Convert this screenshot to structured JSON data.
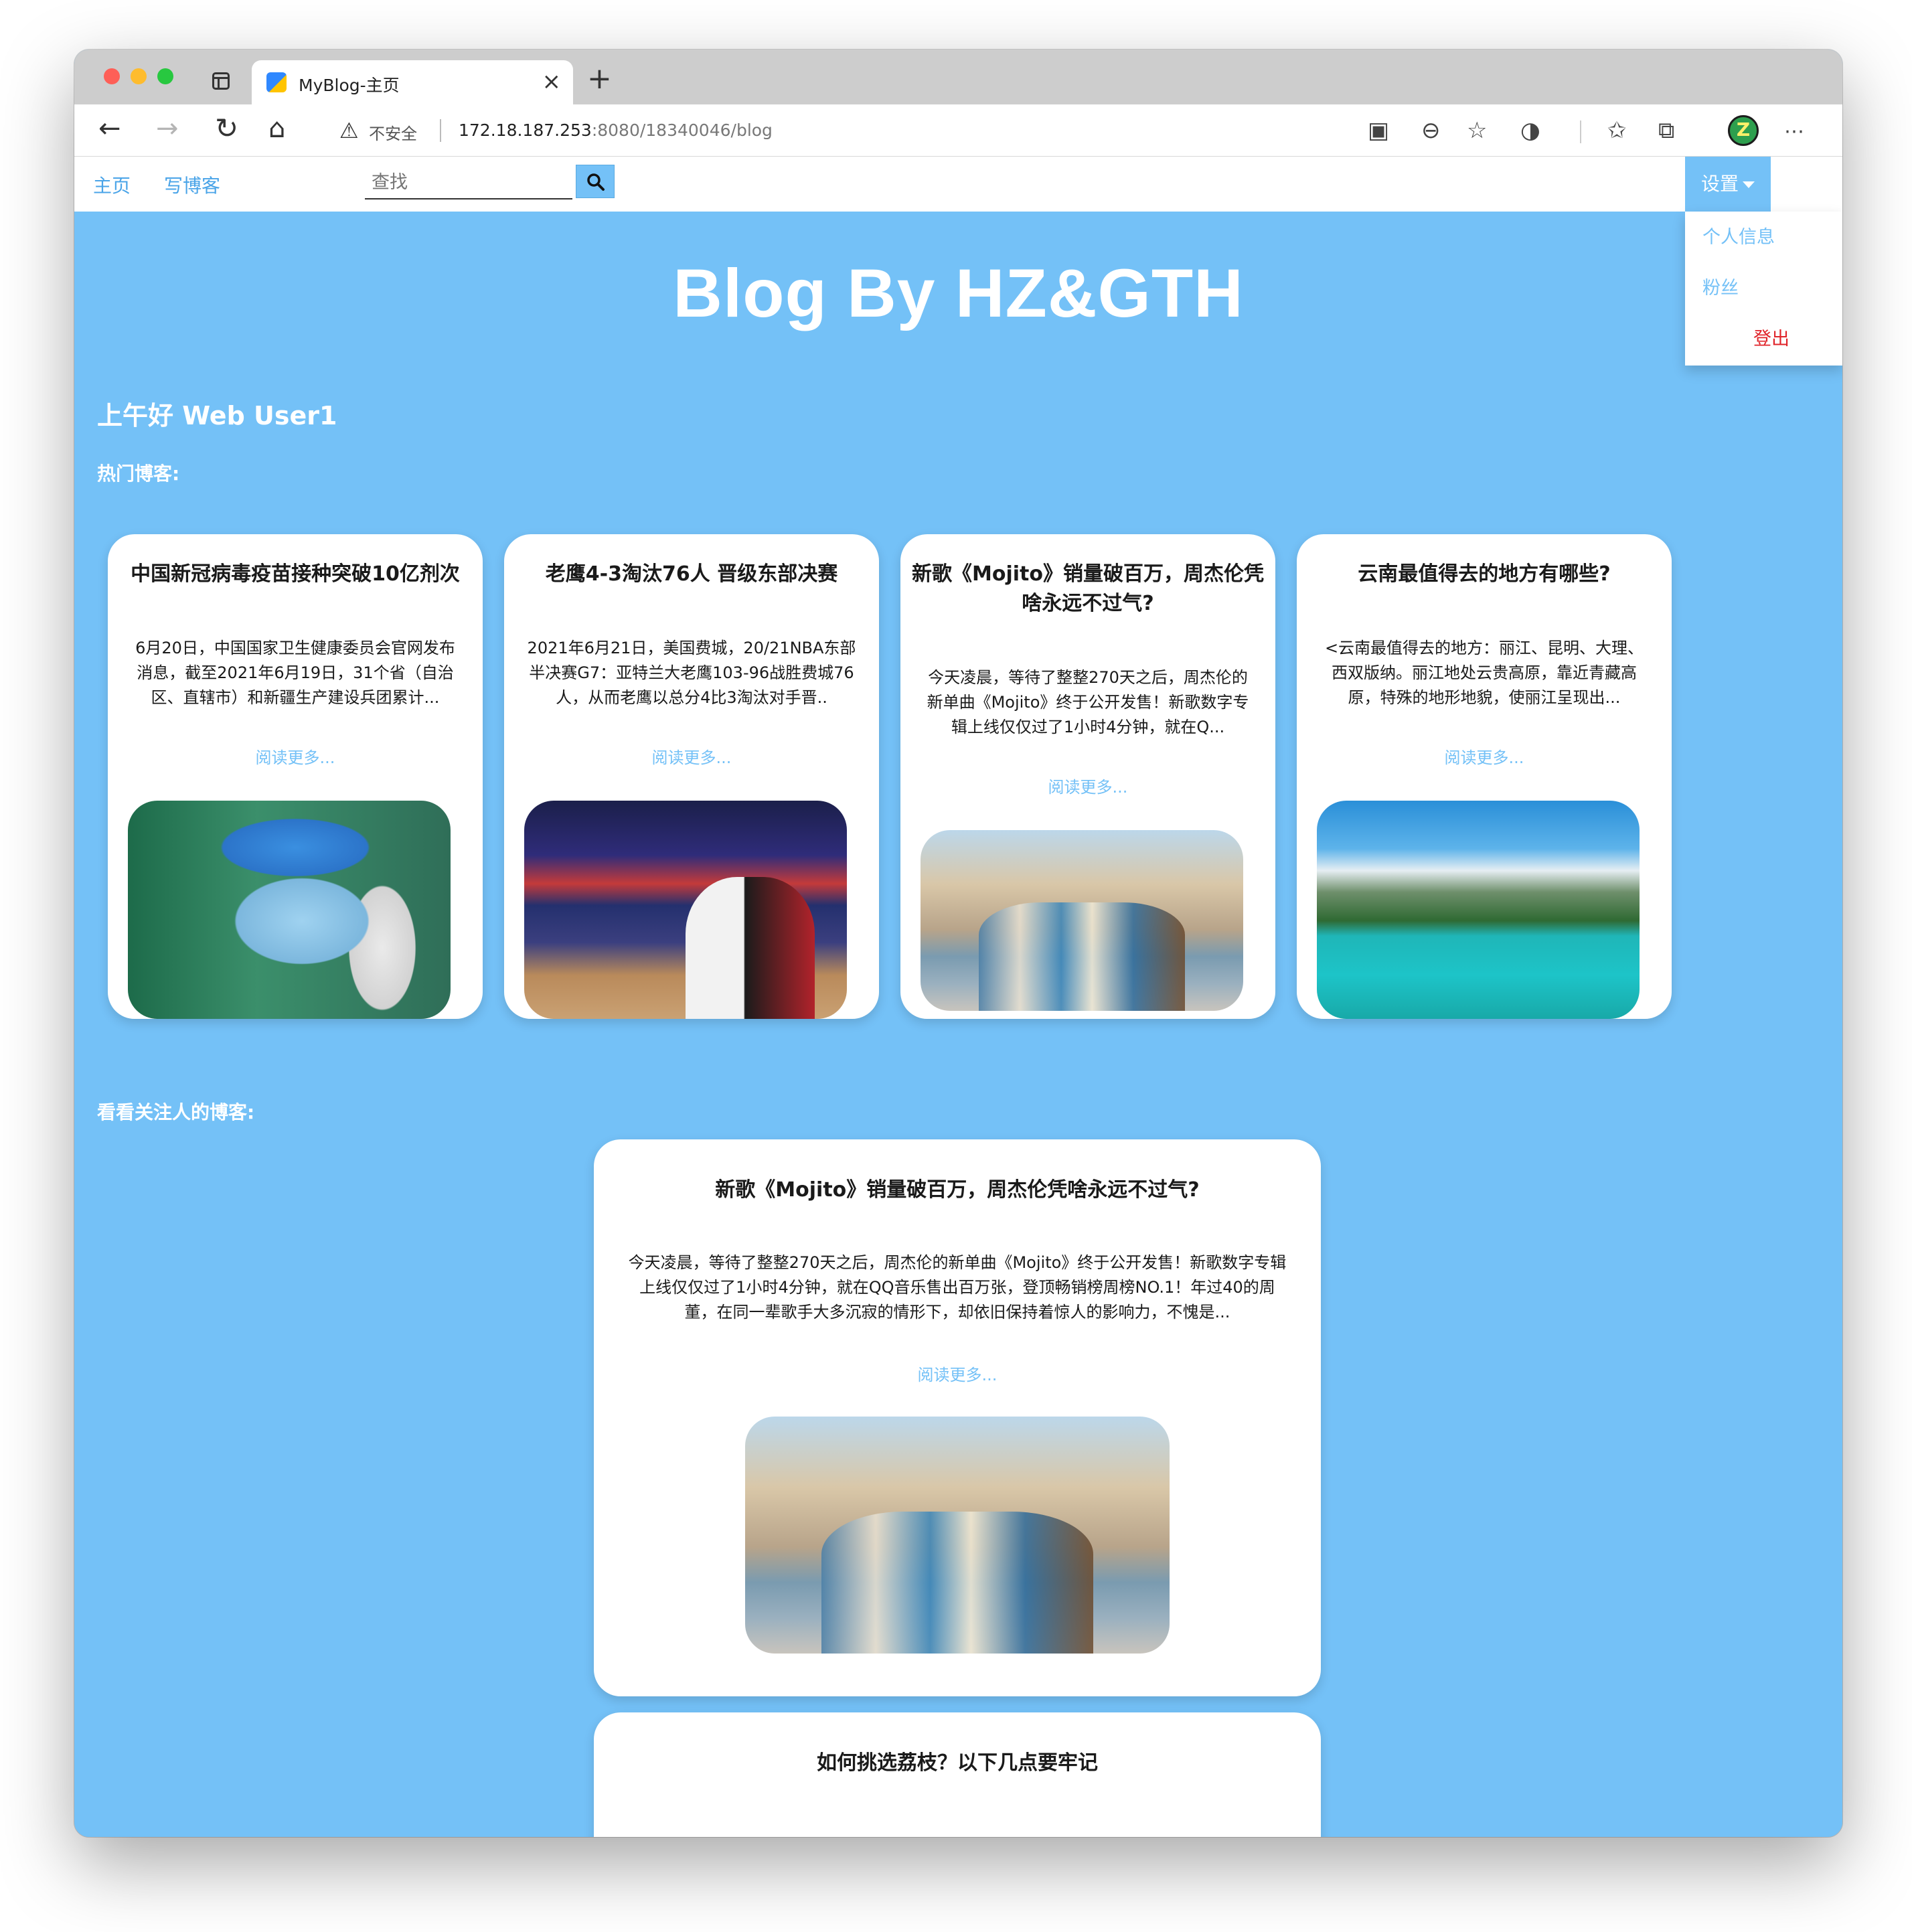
{
  "browser": {
    "tab_title": "MyBlog-主页",
    "security_label": "不安全",
    "url_host": "172.18.187.253",
    "url_rest": ":8080/18340046/blog"
  },
  "nav": {
    "home": "主页",
    "write": "写博客",
    "search_placeholder": "查找",
    "settings": "设置",
    "menu": {
      "profile": "个人信息",
      "fans": "粉丝",
      "logout": "登出"
    }
  },
  "site_title": "Blog By HZ&GTH",
  "greeting": "上午好 Web User1",
  "sections": {
    "hot": "热门博客:",
    "following": "看看关注人的博客:"
  },
  "hot_posts": [
    {
      "title": "中国新冠病毒疫苗接种突破10亿剂次",
      "excerpt": "6月20日，中国国家卫生健康委员会官网发布消息，截至2021年6月19日，31个省（自治区、直辖市）和新疆生产建设兵团累计...",
      "more": "阅读更多..."
    },
    {
      "title": "老鹰4-3淘汰76人 晋级东部决赛",
      "excerpt": "2021年6月21日，美国费城，20/21NBA东部半决赛G7：亚特兰大老鹰103-96战胜费城76人，从而老鹰以总分4比3淘汰对手晋..",
      "more": "阅读更多..."
    },
    {
      "title": "新歌《Mojito》销量破百万，周杰伦凭啥永远不过气?",
      "excerpt": "今天凌晨，等待了整整270天之后，周杰伦的新单曲《Mojito》终于公开发售！新歌数字专辑上线仅仅过了1小时4分钟，就在Q...",
      "more": "阅读更多..."
    },
    {
      "title": "云南最值得去的地方有哪些?",
      "excerpt": "<云南最值得去的地方：丽江、昆明、大理、西双版纳。丽江地处云贵高原，靠近青藏高原，特殊的地形地貌，使丽江呈现出...",
      "more": "阅读更多..."
    }
  ],
  "follow_posts": [
    {
      "title": "新歌《Mojito》销量破百万，周杰伦凭啥永远不过气?",
      "excerpt": "今天凌晨，等待了整整270天之后，周杰伦的新单曲《Mojito》终于公开发售！新歌数字专辑上线仅仅过了1小时4分钟，就在QQ音乐售出百万张，登顶畅销榜周榜NO.1！年过40的周董，在同一辈歌手大多沉寂的情形下，却依旧保持着惊人的影响力，不愧是...",
      "more": "阅读更多..."
    },
    {
      "title": "如何挑选荔枝？以下几点要牢记"
    }
  ]
}
